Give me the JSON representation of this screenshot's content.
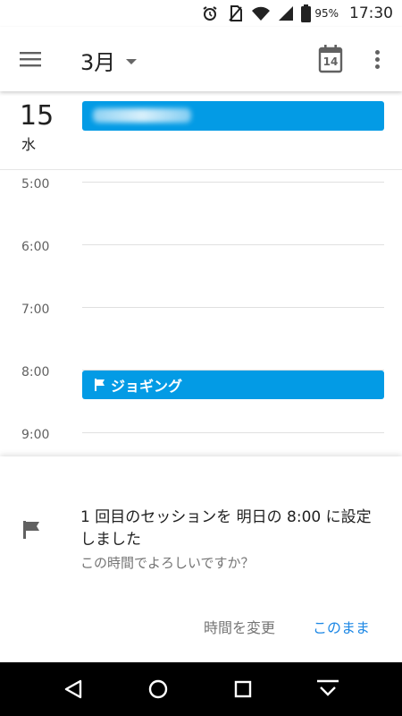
{
  "status_bar": {
    "battery_percent": "95%",
    "time": "17:30",
    "icons": [
      "alarm-icon",
      "no-sim-icon",
      "wifi-icon",
      "signal-icon",
      "battery-icon"
    ]
  },
  "app_bar": {
    "month": "3月",
    "today_number": "14"
  },
  "day_header": {
    "day_number": "15",
    "weekday": "水"
  },
  "timeline": {
    "hours": [
      "5:00",
      "6:00",
      "7:00",
      "8:00",
      "9:00"
    ],
    "events": [
      {
        "title": "ジョギング",
        "start": "8:00"
      }
    ]
  },
  "sheet": {
    "title": "1 回目のセッションを 明日の 8:00 に設定しました",
    "subtitle": "この時間でよろしいですか？",
    "change_label": "時間を変更",
    "keep_label": "このまま"
  },
  "colors": {
    "event_blue": "#039be5",
    "accent_blue": "#1e88e5"
  }
}
